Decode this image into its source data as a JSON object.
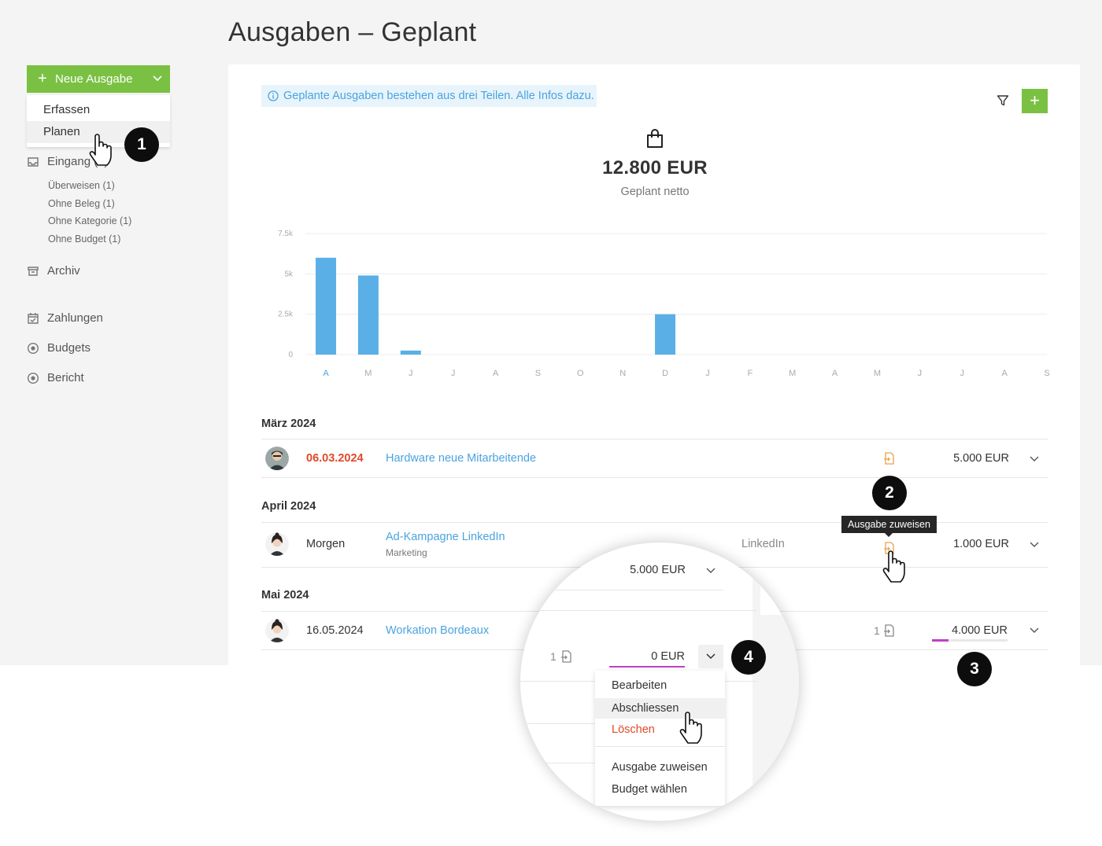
{
  "page": {
    "title": "Ausgaben – Geplant"
  },
  "sidebar": {
    "new_button": {
      "label": "Neue Ausgabe"
    },
    "new_menu": [
      "Erfassen",
      "Planen"
    ],
    "inbox": {
      "label": "Eingang (4)"
    },
    "inbox_sub": [
      "Überweisen (1)",
      "Ohne Beleg (1)",
      "Ohne Kategorie (1)",
      "Ohne Budget (1)"
    ],
    "nav": [
      "Archiv",
      "Zahlungen",
      "Budgets",
      "Bericht"
    ]
  },
  "panel": {
    "info_text": "Geplante Ausgaben bestehen aus drei Teilen. Alle Infos dazu.",
    "total": "12.800 EUR",
    "total_sub": "Geplant netto"
  },
  "chart_data": {
    "type": "bar",
    "categories": [
      "A",
      "M",
      "J",
      "J",
      "A",
      "S",
      "O",
      "N",
      "D",
      "J",
      "F",
      "M",
      "A",
      "M",
      "J",
      "J",
      "A",
      "S"
    ],
    "values": [
      6000,
      4900,
      250,
      0,
      0,
      0,
      0,
      0,
      2500,
      0,
      0,
      0,
      0,
      0,
      0,
      0,
      0,
      0
    ],
    "yticks": [
      "0",
      "2.5k",
      "5k",
      "7.5k"
    ],
    "ylim": [
      0,
      7500
    ],
    "highlighted_category_index": 0,
    "bar_color": "#5aafe6",
    "grid": true
  },
  "groups": [
    {
      "month": "März 2024",
      "rows": [
        {
          "date": "06.03.2024",
          "title": "Hardware neue Mitarbeitende",
          "amount": "5.000 EUR",
          "date_overdue": true
        }
      ]
    },
    {
      "month": "April 2024",
      "rows": [
        {
          "date": "Morgen",
          "title": "Ad-Kampagne LinkedIn",
          "subtitle": "Marketing",
          "vendor": "LinkedIn",
          "amount": "1.000 EUR"
        }
      ]
    },
    {
      "month": "Mai 2024",
      "rows": [
        {
          "date": "16.05.2024",
          "title": "Workation Bordeaux",
          "doc_count": "1",
          "amount": "4.000 EUR",
          "budget_fraction": 0.22
        }
      ]
    }
  ],
  "tooltip": "Ausgabe zuweisen",
  "badges": [
    "1",
    "2",
    "3",
    "4"
  ],
  "magnifier": {
    "amount_top": "5.000 EUR",
    "doc_count": "1",
    "amount_zero": "0 EUR",
    "menu": [
      "Bearbeiten",
      "Abschliessen",
      "Löschen",
      "Ausgabe zuweisen",
      "Budget wählen"
    ]
  },
  "colors": {
    "accent_green": "#7ac143",
    "link_blue": "#4aa3df",
    "danger_red": "#e0492a",
    "budget_magenta": "#c23fc2",
    "doc_orange": "#e8a24a"
  }
}
